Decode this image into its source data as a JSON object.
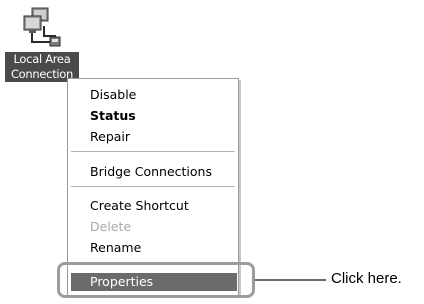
{
  "desktop_icon": {
    "name": "network-connection-icon",
    "label_lines": [
      "Local Area",
      "Connection"
    ]
  },
  "context_menu": {
    "items": [
      {
        "label": "Disable",
        "style": "normal"
      },
      {
        "label": "Status",
        "style": "bold"
      },
      {
        "label": "Repair",
        "style": "normal"
      },
      {
        "label": "Bridge Connections",
        "style": "normal"
      },
      {
        "label": "Create Shortcut",
        "style": "normal"
      },
      {
        "label": "Delete",
        "style": "disabled"
      },
      {
        "label": "Rename",
        "style": "normal"
      },
      {
        "label": "Properties",
        "style": "highlighted"
      }
    ]
  },
  "callout": {
    "text": "Click here."
  },
  "colors": {
    "highlight_bg": "#6b6b6b",
    "disabled_text": "#a8a8a8",
    "callout_border": "#9c9c9c"
  }
}
